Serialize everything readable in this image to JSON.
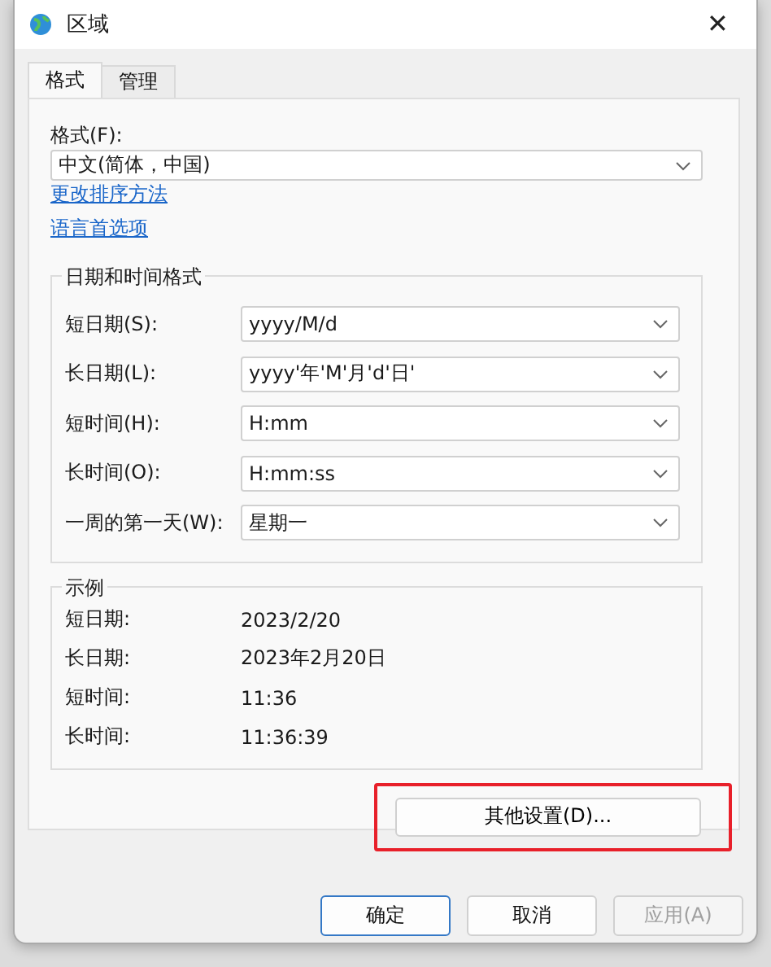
{
  "window": {
    "title": "区域",
    "close": "✕"
  },
  "tabs": [
    {
      "label": "格式",
      "selected": true
    },
    {
      "label": "管理",
      "selected": false
    }
  ],
  "format": {
    "label": "格式(F):",
    "value": "中文(简体，中国)"
  },
  "links": [
    "更改排序方法",
    "语言首选项"
  ],
  "datetime_group": {
    "title": "日期和时间格式",
    "rows": [
      {
        "label": "短日期(S):",
        "value": "yyyy/M/d"
      },
      {
        "label": "长日期(L):",
        "value": "yyyy'年'M'月'd'日'"
      },
      {
        "label": "短时间(H):",
        "value": "H:mm"
      },
      {
        "label": "长时间(O):",
        "value": "H:mm:ss"
      },
      {
        "label": "一周的第一天(W):",
        "value": "星期一"
      }
    ]
  },
  "example_group": {
    "title": "示例",
    "rows": [
      {
        "label": "短日期:",
        "value": "2023/2/20"
      },
      {
        "label": "长日期:",
        "value": "2023年2月20日"
      },
      {
        "label": "短时间:",
        "value": "11:36"
      },
      {
        "label": "长时间:",
        "value": "11:36:39"
      }
    ]
  },
  "other_settings": {
    "label": "其他设置(D)...",
    "highlighted": true
  },
  "buttons": [
    {
      "label": "确定",
      "default": true,
      "disabled": false
    },
    {
      "label": "取消",
      "default": false,
      "disabled": false
    },
    {
      "label": "应用(A)",
      "default": false,
      "disabled": true
    }
  ]
}
